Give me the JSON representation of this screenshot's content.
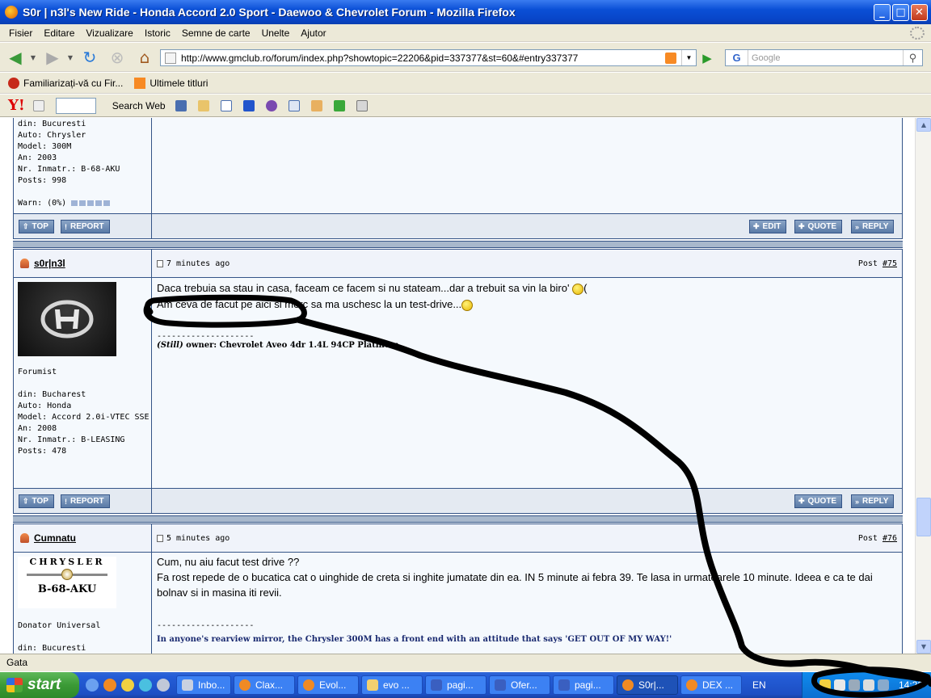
{
  "window": {
    "title": "S0r | n3l's New Ride - Honda Accord 2.0 Sport - Daewoo & Chevrolet Forum - Mozilla Firefox"
  },
  "menu": [
    "Fisier",
    "Editare",
    "Vizualizare",
    "Istoric",
    "Semne de carte",
    "Unelte",
    "Ajutor"
  ],
  "nav": {
    "url": "http://www.gmclub.ro/forum/index.php?showtopic=22206&pid=337377&st=60&#entry337377",
    "search_placeholder": "Google",
    "search_engine": "G"
  },
  "bookmarks": [
    "Familiarizați-vă cu Fir...",
    "Ultimele titluri"
  ],
  "yahoo_toolbar": {
    "logo": "Y!",
    "search_web": "Search Web"
  },
  "post_prev": {
    "profile": [
      "din: Bucuresti",
      "Auto: Chrysler",
      "Model: 300M",
      "An: 2003",
      "Nr. Inmatr.: B-68-AKU",
      "Posts: 998",
      "",
      "Warn: (0%)"
    ],
    "buttons": {
      "top": "TOP",
      "report": "REPORT",
      "edit": "EDIT",
      "quote": "QUOTE",
      "reply": "REPLY"
    }
  },
  "post_75": {
    "username": "s0r|n3l",
    "time": "7 minutes ago",
    "post_label": "Post ",
    "post_num": "#75",
    "rank": "Forumist",
    "profile": [
      "din: Bucharest",
      "Auto: Honda",
      "Model: Accord 2.0i-VTEC SSE",
      "An: 2008",
      "Nr. Inmatr.: B-LEASING",
      "Posts: 478"
    ],
    "line1": "Daca trebuia sa stau in casa, faceam ce facem si nu stateam...dar a trebuit sa vin la biro'",
    "line1_tail": "(",
    "line2": "Am ceva de facut pe aici si merc sa ma uschesc la un test-drive...",
    "sig_sep": "--------------------",
    "sig_italic": "(Still)",
    "sig_text": " owner: Chevrolet Aveo 4dr 1.4L 94CP Platinum",
    "buttons": {
      "top": "TOP",
      "report": "REPORT",
      "quote": "QUOTE",
      "reply": "REPLY"
    }
  },
  "post_76": {
    "username": "Cumnatu",
    "time": "5 minutes ago",
    "post_label": "Post ",
    "post_num": "#76",
    "avatar_brand": "CHRYSLER",
    "avatar_plate": "B-68-AKU",
    "rank": "Donator Universal",
    "profile": [
      "din: Bucuresti"
    ],
    "line1": "Cum, nu aiu facut test drive ??",
    "line2": "Fa rost repede de o bucatica cat o uinghide de creta si inghite jumatate din ea. IN 5 minute ai febra 39. Te lasa in urmatoarele 10 minute. Ideea e ca te dai bolnav si in masina iti revii.",
    "sig_sep": "--------------------",
    "sig_text": "In anyone's rearview mirror, the Chrysler 300M has a front end with an attitude that says 'GET OUT OF MY WAY!'"
  },
  "status": "Gata",
  "taskbar": {
    "start": "start",
    "tasks": [
      "Inbo...",
      "Clax...",
      "Evol...",
      "evo ...",
      "pagi...",
      "Ofer...",
      "pagi...",
      "S0r|...",
      "DEX ..."
    ],
    "active_task": "S0r|...",
    "lang": "EN",
    "clock": "14:22"
  },
  "colors": {
    "forum_border": "#345487",
    "post_bg": "#f5f9fd",
    "button_bg": "#5a7aa6",
    "xp_blue": "#245dd7"
  }
}
